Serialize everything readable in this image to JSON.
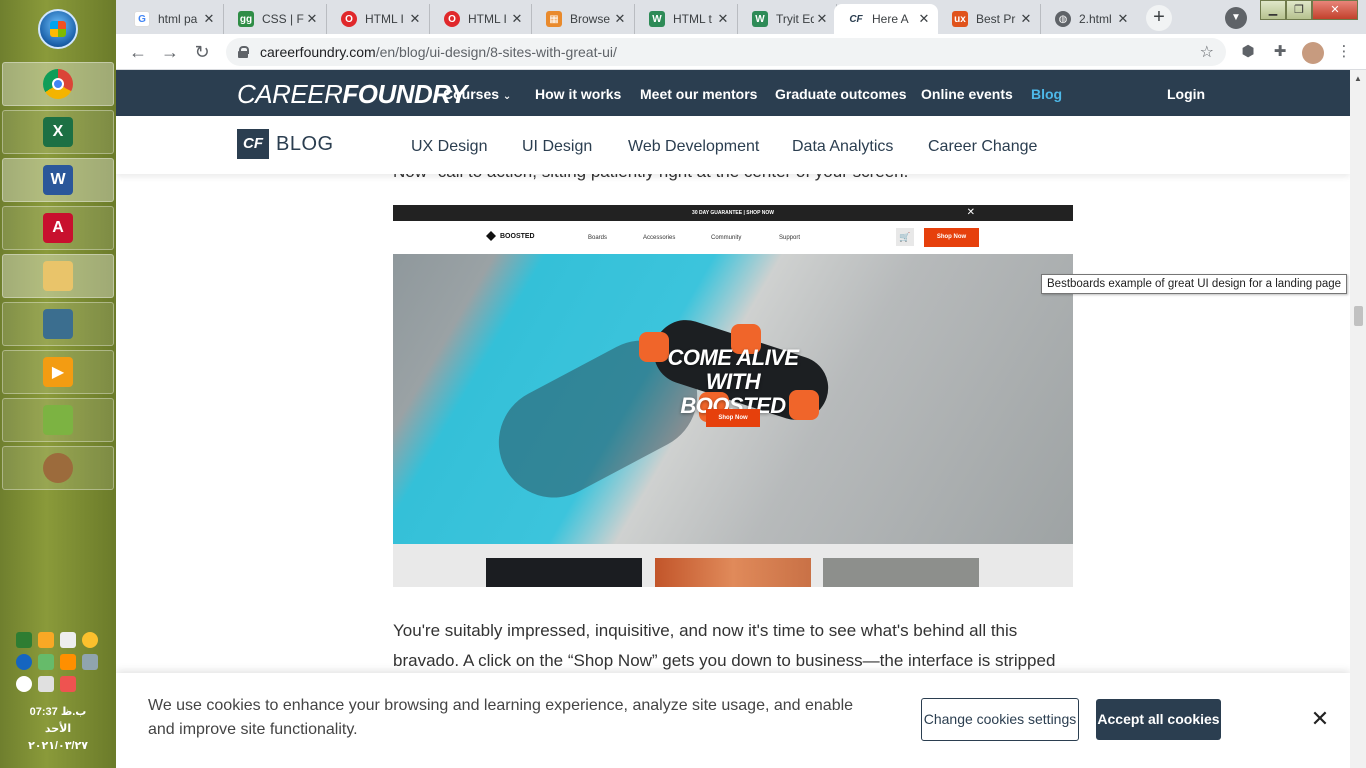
{
  "browser": {
    "tabs": [
      {
        "title": "html pa",
        "favicon": "google-icon",
        "color": "#4285f4"
      },
      {
        "title": "CSS | Fo",
        "favicon": "geeksforgeeks-icon",
        "color": "#2f8d46"
      },
      {
        "title": "HTML I",
        "favicon": "opera-icon",
        "color": "#e0282b"
      },
      {
        "title": "HTML I",
        "favicon": "opera-icon",
        "color": "#e0282b"
      },
      {
        "title": "Browse",
        "favicon": "grid-icon",
        "color": "#e98a2c"
      },
      {
        "title": "HTML t",
        "favicon": "w3-icon",
        "color": "#2e8b57"
      },
      {
        "title": "Tryit Ed",
        "favicon": "w3-icon",
        "color": "#2e8b57"
      },
      {
        "title": "Here A",
        "favicon": "careerfoundry-icon",
        "color": "#2b3e50"
      },
      {
        "title": "Best Pr",
        "favicon": "ux-icon",
        "color": "#e0531c"
      },
      {
        "title": "2.html",
        "favicon": "globe-icon",
        "color": "#5f6368"
      }
    ],
    "url_domain": "careerfoundry.com",
    "url_path": "/en/blog/ui-design/8-sites-with-great-ui/"
  },
  "site_nav": {
    "logo_light": "CAREER",
    "logo_bold": "FOUNDRY",
    "items": [
      "Courses",
      "How it works",
      "Meet our mentors",
      "Graduate outcomes",
      "Online events",
      "Blog"
    ],
    "login": "Login"
  },
  "subnav": {
    "badge": "CF",
    "label": "BLOG",
    "items": [
      "UX Design",
      "UI Design",
      "Web Development",
      "Data Analytics",
      "Career Change"
    ]
  },
  "article": {
    "cut_line": "Now\" call to action, sitting patiently right at the center of your screen.",
    "paragraph": "You're suitably impressed, inquisitive, and now it's time to see what's behind all this bravado. A click on the “Shop Now” gets you down to business—the interface is stripped",
    "tooltip": "Bestboards example of great UI design for a landing page"
  },
  "hero_image": {
    "banner": "30 DAY GUARANTEE | SHOP NOW",
    "brand": "BOOSTED",
    "nav": [
      "Boards",
      "Accessories",
      "Community",
      "Support"
    ],
    "shop_now": "Shop Now",
    "headline_1": "COME ALIVE",
    "headline_2": "WITH BOOSTED",
    "cta": "Shop Now"
  },
  "cookie": {
    "text": "We use cookies to enhance your browsing and learning experience, analyze site usage, and enable and improve site functionality.",
    "settings": "Change cookies settings",
    "accept": "Accept all cookies"
  },
  "taskbar": {
    "apps": [
      "chrome",
      "excel",
      "word",
      "acrobat",
      "explorer",
      "remote-desktop",
      "media-player",
      "notepad",
      "paint"
    ],
    "clock_time": "07:37 ب.ظ",
    "clock_day": "الأحد",
    "clock_date": "٢٠٢١/٠٣/٢٧"
  },
  "colors": {
    "brand_navy": "#2b3e50",
    "brand_blue": "#4db8e8",
    "boosted_orange": "#e6400c"
  }
}
